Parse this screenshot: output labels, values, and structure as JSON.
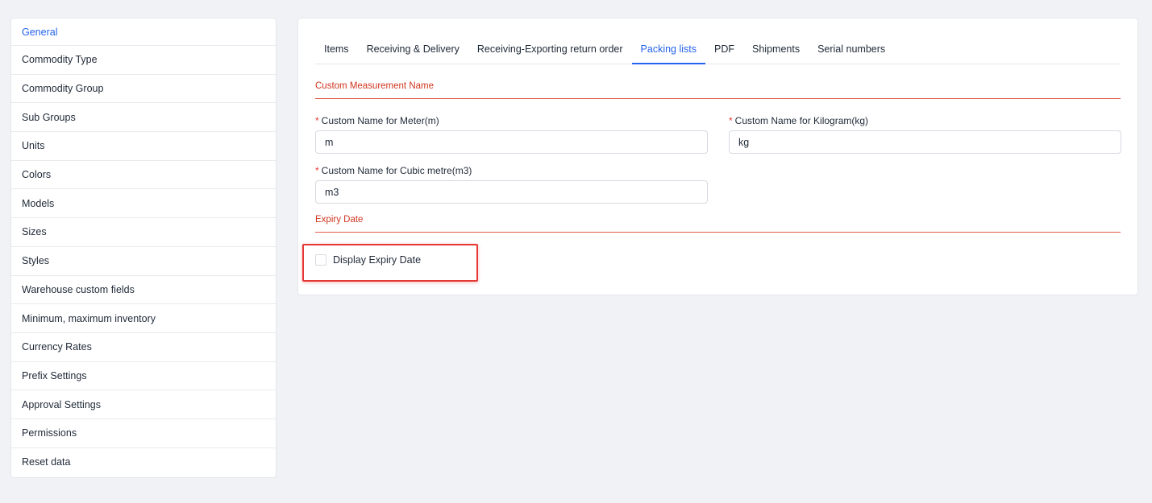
{
  "sidebar": {
    "items": [
      {
        "label": "General",
        "active": true
      },
      {
        "label": "Commodity Type"
      },
      {
        "label": "Commodity Group"
      },
      {
        "label": "Sub Groups"
      },
      {
        "label": "Units"
      },
      {
        "label": "Colors"
      },
      {
        "label": "Models"
      },
      {
        "label": "Sizes"
      },
      {
        "label": "Styles"
      },
      {
        "label": "Warehouse custom fields"
      },
      {
        "label": "Minimum, maximum inventory"
      },
      {
        "label": "Currency Rates"
      },
      {
        "label": "Prefix Settings"
      },
      {
        "label": "Approval Settings"
      },
      {
        "label": "Permissions"
      },
      {
        "label": "Reset data"
      }
    ]
  },
  "tabs": [
    {
      "label": "Items"
    },
    {
      "label": "Receiving & Delivery"
    },
    {
      "label": "Receiving-Exporting return order"
    },
    {
      "label": "Packing lists",
      "active": true
    },
    {
      "label": "PDF"
    },
    {
      "label": "Shipments"
    },
    {
      "label": "Serial numbers"
    }
  ],
  "sections": {
    "custom_measurement": {
      "title": "Custom Measurement Name",
      "fields": {
        "meter": {
          "required_mark": "*",
          "label": "Custom Name for Meter(m)",
          "value": "m"
        },
        "kilogram": {
          "required_mark": "*",
          "label": "Custom Name for Kilogram(kg)",
          "value": "kg"
        },
        "cubic": {
          "required_mark": "*",
          "label": "Custom Name for Cubic metre(m3)",
          "value": "m3"
        }
      }
    },
    "expiry": {
      "title": "Expiry Date",
      "checkbox_label": "Display Expiry Date",
      "checked": false
    }
  },
  "colors": {
    "accent": "#2563eb",
    "section_title": "#d1351f",
    "required": "#e53935",
    "highlight": "#e53935",
    "background": "#f0f2f6"
  }
}
